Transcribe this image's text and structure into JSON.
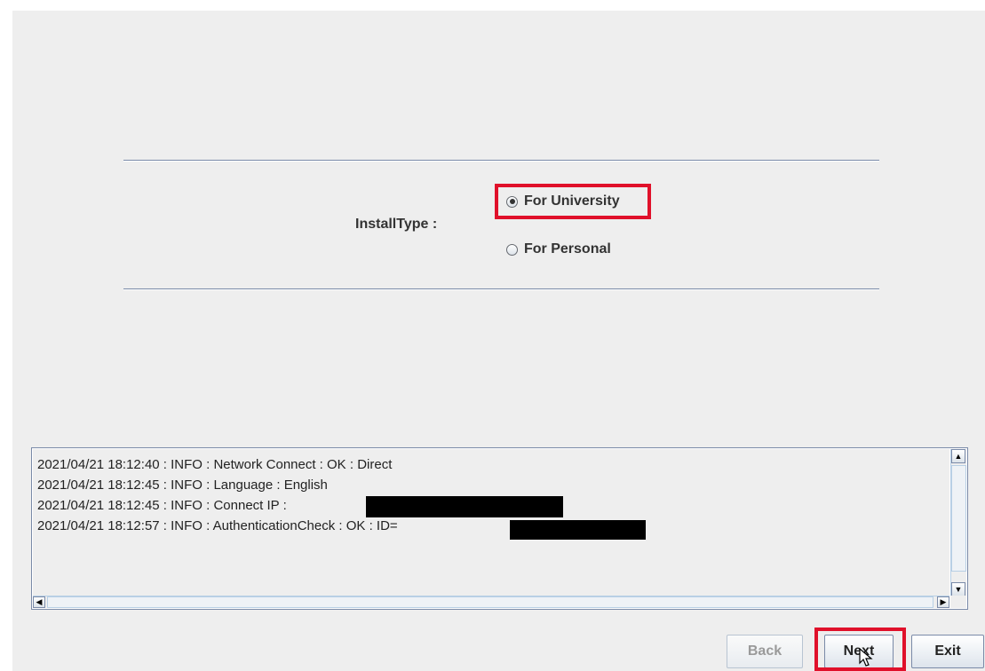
{
  "install_type": {
    "label": "InstallType :",
    "options": [
      {
        "label": "For University",
        "selected": true
      },
      {
        "label": "For Personal",
        "selected": false
      }
    ]
  },
  "log": {
    "lines": [
      "2021/04/21 18:12:40 : INFO  : Network Connect : OK : Direct",
      "2021/04/21 18:12:45 : INFO  : Language : English",
      "2021/04/21 18:12:45 : INFO  : Connect IP :",
      "2021/04/21 18:12:57 : INFO  : AuthenticationCheck : OK : ID="
    ]
  },
  "buttons": {
    "back": "Back",
    "next": "Next",
    "exit": "Exit"
  },
  "colors": {
    "highlight": "#e0102a",
    "separator": "#7a8aa8"
  },
  "icons": {
    "scroll_up": "▲",
    "scroll_down": "▼",
    "scroll_left": "◀",
    "scroll_right": "▶"
  }
}
